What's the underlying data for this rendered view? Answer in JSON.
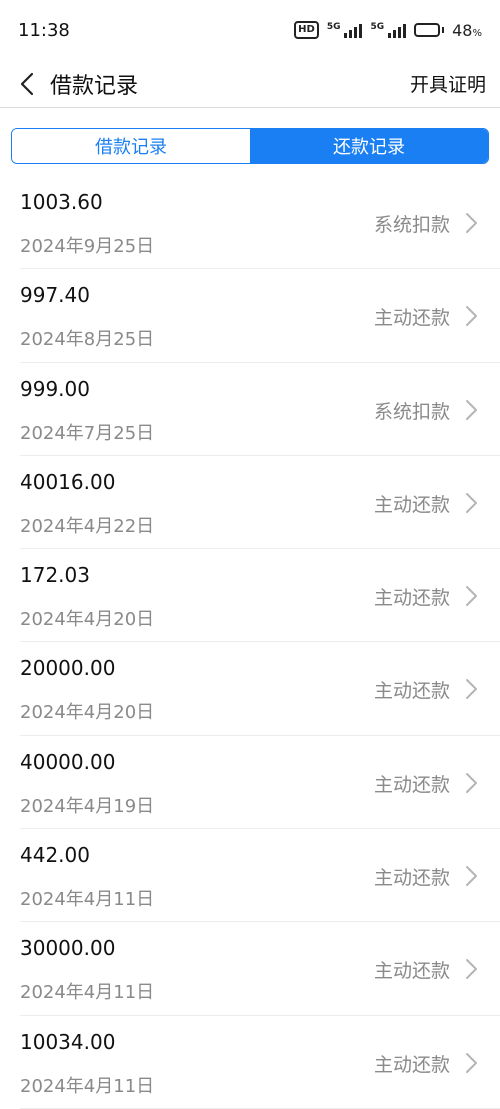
{
  "status_bar": {
    "time": "11:38",
    "hd_label": "HD",
    "network1": "5G",
    "network2": "5G",
    "battery_percent": "48",
    "battery_unit": "%"
  },
  "header": {
    "title": "借款记录",
    "action_label": "开具证明"
  },
  "tabs": [
    {
      "label": "借款记录",
      "active": false
    },
    {
      "label": "还款记录",
      "active": true
    }
  ],
  "records": [
    {
      "amount": "1003.60",
      "date": "2024年9月25日",
      "type": "系统扣款"
    },
    {
      "amount": "997.40",
      "date": "2024年8月25日",
      "type": "主动还款"
    },
    {
      "amount": "999.00",
      "date": "2024年7月25日",
      "type": "系统扣款"
    },
    {
      "amount": "40016.00",
      "date": "2024年4月22日",
      "type": "主动还款"
    },
    {
      "amount": "172.03",
      "date": "2024年4月20日",
      "type": "主动还款"
    },
    {
      "amount": "20000.00",
      "date": "2024年4月20日",
      "type": "主动还款"
    },
    {
      "amount": "40000.00",
      "date": "2024年4月19日",
      "type": "主动还款"
    },
    {
      "amount": "442.00",
      "date": "2024年4月11日",
      "type": "主动还款"
    },
    {
      "amount": "30000.00",
      "date": "2024年4月11日",
      "type": "主动还款"
    },
    {
      "amount": "10034.00",
      "date": "2024年4月11日",
      "type": "主动还款"
    }
  ],
  "icons": {
    "back": "chevron-left-icon",
    "row_arrow": "chevron-right-icon"
  },
  "colors": {
    "accent": "#1a7ff2",
    "secondary_text": "#8a8a8a"
  }
}
